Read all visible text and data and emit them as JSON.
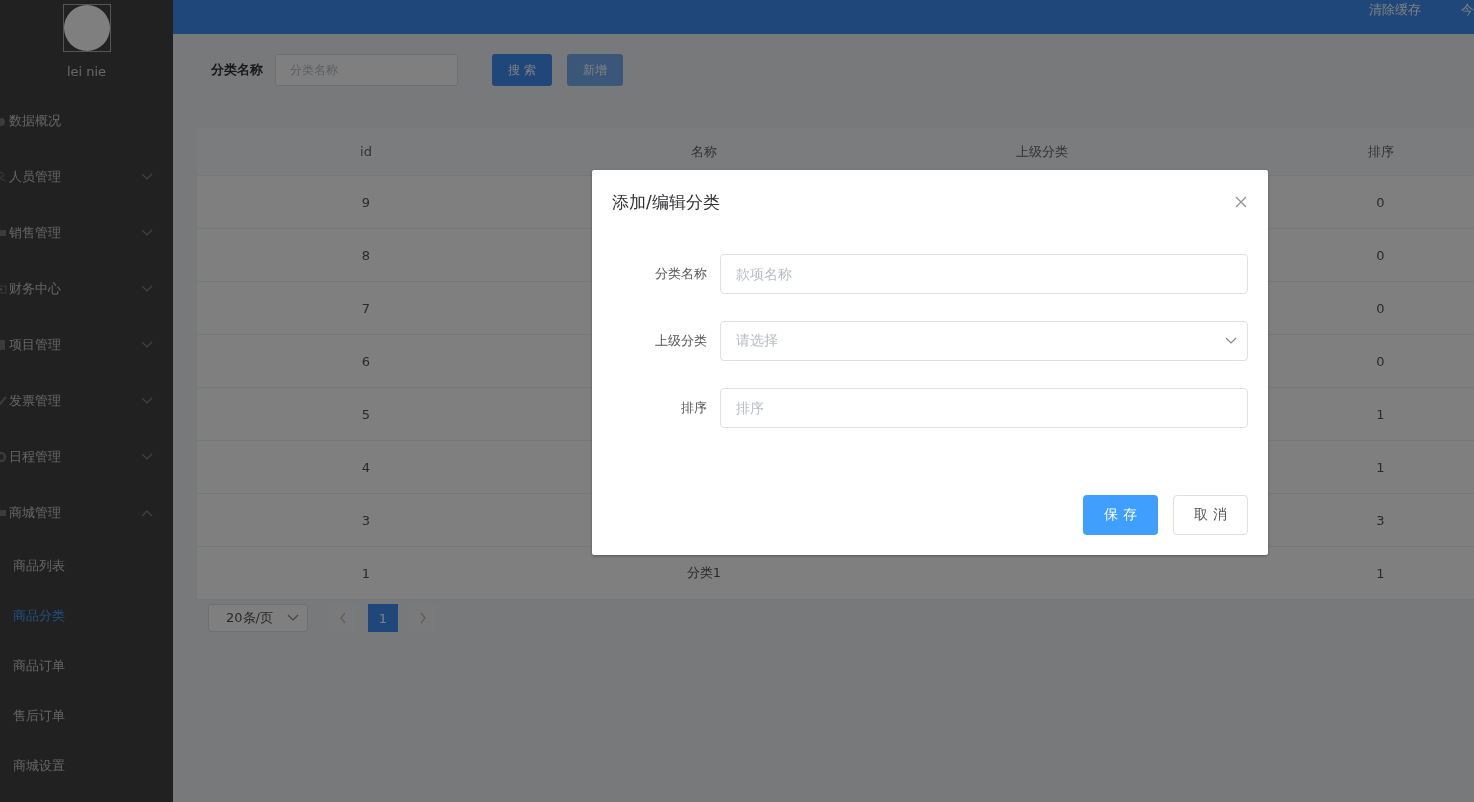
{
  "sidebar": {
    "user": {
      "name": "lei nie"
    },
    "menu": [
      {
        "label": "数据概况",
        "kind": "dashboard",
        "expandable": false
      },
      {
        "label": "人员管理",
        "kind": "user",
        "expandable": true,
        "expanded": false
      },
      {
        "label": "销售管理",
        "kind": "chat",
        "expandable": true,
        "expanded": false
      },
      {
        "label": "财务中心",
        "kind": "money",
        "expandable": true,
        "expanded": false
      },
      {
        "label": "项目管理",
        "kind": "file",
        "expandable": true,
        "expanded": false
      },
      {
        "label": "发票管理",
        "kind": "check",
        "expandable": true,
        "expanded": false
      },
      {
        "label": "日程管理",
        "kind": "gear",
        "expandable": true,
        "expanded": false
      },
      {
        "label": "商城管理",
        "kind": "chat",
        "expandable": true,
        "expanded": true,
        "children": [
          {
            "label": "商品列表",
            "selected": false
          },
          {
            "label": "商品分类",
            "selected": true
          },
          {
            "label": "商品订单",
            "selected": false
          },
          {
            "label": "售后订单",
            "selected": false
          },
          {
            "label": "商城设置",
            "selected": false
          }
        ]
      }
    ]
  },
  "header": {
    "links": [
      "清除缓存",
      "今"
    ]
  },
  "search": {
    "label": "分类名称",
    "placeholder": "分类名称",
    "buttons": [
      {
        "label": "搜 索",
        "kind": "primary"
      },
      {
        "label": "新增",
        "kind": "secondary"
      }
    ]
  },
  "table": {
    "columns": [
      "id",
      "名称",
      "上级分类",
      "排序"
    ],
    "rows": [
      {
        "id": "9",
        "sort": "0"
      },
      {
        "id": "8",
        "sort": "0"
      },
      {
        "id": "7",
        "sort": "0"
      },
      {
        "id": "6",
        "sort": "0"
      },
      {
        "id": "5",
        "sort": "1"
      },
      {
        "id": "4",
        "sort": "1"
      },
      {
        "id": "3",
        "sort": "3"
      },
      {
        "id": "1",
        "name": "分类1",
        "sort": "1"
      }
    ]
  },
  "pagination": {
    "page_size": "20条/页",
    "pages": [
      {
        "label": "1",
        "selected": true
      }
    ]
  },
  "dialog": {
    "title": "添加/编辑分类",
    "fields": [
      {
        "label": "分类名称",
        "placeholder": "款项名称",
        "kind": "text"
      },
      {
        "label": "上级分类",
        "placeholder": "请选择",
        "kind": "select"
      },
      {
        "label": "排序",
        "placeholder": "排序",
        "kind": "text"
      }
    ],
    "buttons": [
      {
        "label": "保 存",
        "kind": "primary"
      },
      {
        "label": "取 消",
        "kind": "default"
      }
    ]
  }
}
